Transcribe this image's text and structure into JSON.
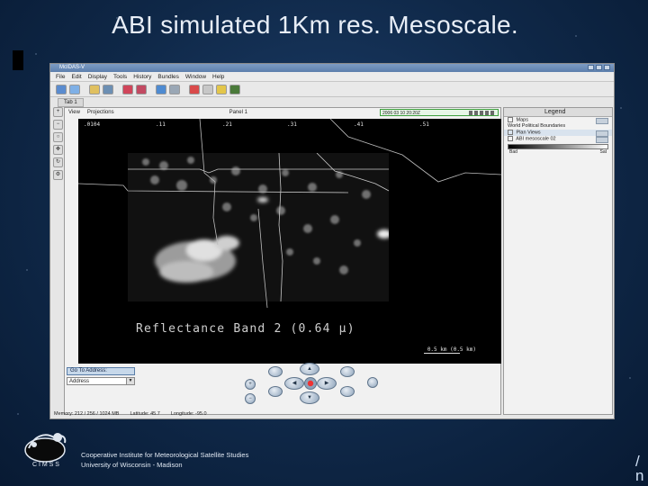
{
  "slide": {
    "title": "ABI simulated 1Km res. Mesoscale.",
    "footer_line1": "Cooperative Institute for Meteorological Satellite Studies",
    "footer_line2": "University of Wisconsin - Madison",
    "logo_text": "C I M S S",
    "corner_glyph": "/ n"
  },
  "window": {
    "title": "McIDAS-V",
    "menu": [
      "File",
      "Edit",
      "Display",
      "Tools",
      "History",
      "Bundles",
      "Window",
      "Help"
    ],
    "toolbar_icons": [
      "globe-icon",
      "map-icon",
      "folder-icon",
      "display-icon",
      "data-icon",
      "data2-icon",
      "globe2-icon",
      "sync-icon",
      "record-icon",
      "stop-icon",
      "pencil-icon",
      "monitor-icon"
    ],
    "tab_label": "Tab 1",
    "view_menu": [
      "View",
      "Projections"
    ],
    "panel_label": "Panel 1",
    "time_readout": "2006 03 10 20:20Z"
  },
  "map": {
    "scale_values": [
      ".0104",
      ".11",
      ".21",
      ".31",
      ".41",
      ".51"
    ],
    "readout": "Reflectance Band 2 (0.64 µ)",
    "scale_label": "0.5 km (0.5 km)"
  },
  "goto": {
    "label": "Go To Address:",
    "value": "Address"
  },
  "legend": {
    "title": "Legend",
    "rows": [
      {
        "label": "Maps",
        "group": false
      },
      {
        "label": "World Political Boundaries",
        "group": false
      },
      {
        "label": "Plan Views",
        "group": true
      },
      {
        "label": "ABI mesoscale 02",
        "group": false
      }
    ],
    "range_min": "Bad",
    "range_max": "Sat"
  },
  "status": {
    "memory": "Memory: 212 / 256 / 1024 MB",
    "latitude": "Latitude: 45.7",
    "longitude": "Longitude: -95.0"
  },
  "colors": {
    "background": "#0f2848",
    "window_chrome": "#e6e6e6",
    "title_text": "#e8eef7"
  }
}
